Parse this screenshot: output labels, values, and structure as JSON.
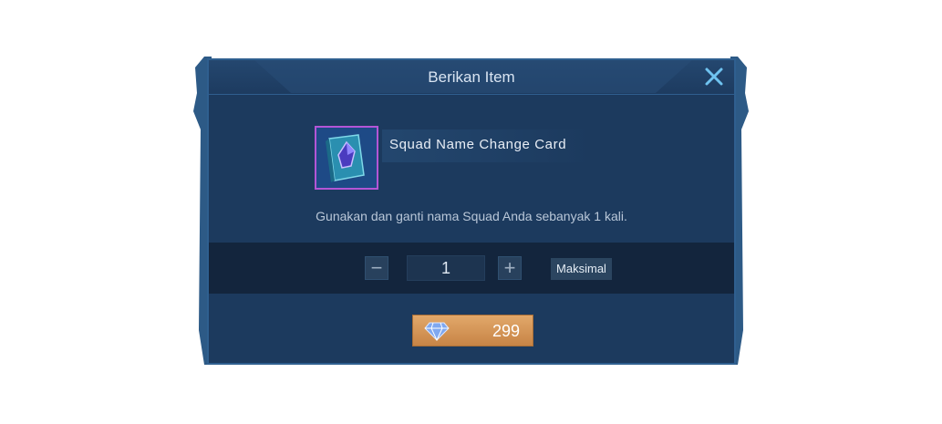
{
  "dialog": {
    "title": "Berikan Item",
    "close_icon": "close-icon"
  },
  "item": {
    "name": "Squad Name Change Card",
    "icon": "book-with-gem-icon",
    "description": "Gunakan dan ganti nama Squad Anda sebanyak 1 kali."
  },
  "quantity": {
    "minus_label": "−",
    "value": "1",
    "plus_label": "+",
    "max_label": "Maksimal"
  },
  "purchase": {
    "currency_icon": "diamond-icon",
    "price": "299"
  },
  "colors": {
    "panel": "#1c3a5e",
    "accent_close": "#6fc3f0",
    "price_button": "#d49457",
    "item_border": "#b455d6"
  }
}
